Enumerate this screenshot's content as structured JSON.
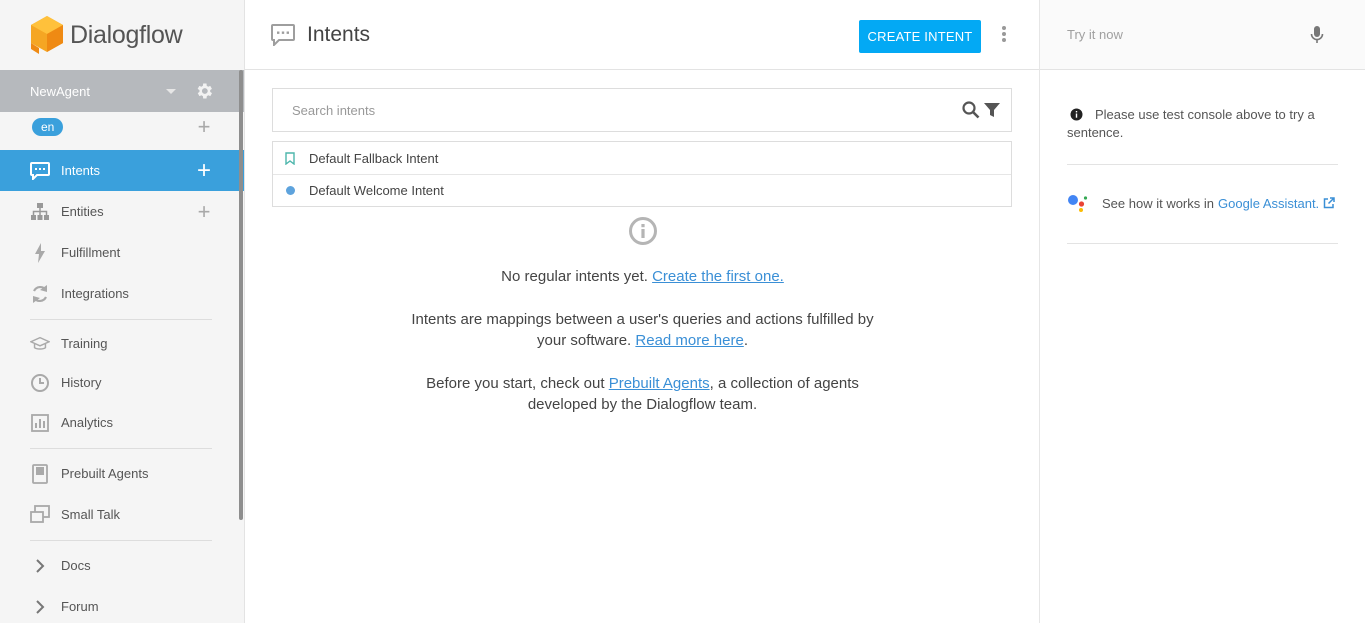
{
  "brand": {
    "name": "Dialogflow"
  },
  "agent": {
    "name": "NewAgent",
    "language": "en"
  },
  "sidebar": {
    "items": [
      {
        "label": "Intents",
        "icon": "chat-icon",
        "active": true,
        "has_add": true
      },
      {
        "label": "Entities",
        "icon": "hierarchy-icon",
        "active": false,
        "has_add": true
      },
      {
        "label": "Fulfillment",
        "icon": "bolt-icon",
        "active": false
      },
      {
        "label": "Integrations",
        "icon": "sync-icon",
        "active": false
      },
      {
        "label": "Training",
        "icon": "graduation-cap-icon",
        "active": false
      },
      {
        "label": "History",
        "icon": "clock-icon",
        "active": false
      },
      {
        "label": "Analytics",
        "icon": "bar-chart-icon",
        "active": false
      },
      {
        "label": "Prebuilt Agents",
        "icon": "book-icon",
        "active": false
      },
      {
        "label": "Small Talk",
        "icon": "chat-bubbles-icon",
        "active": false
      },
      {
        "label": "Docs",
        "icon": "chevron-right-icon",
        "active": false
      },
      {
        "label": "Forum",
        "icon": "chevron-right-icon",
        "active": false
      }
    ]
  },
  "main": {
    "title": "Intents",
    "create_label": "CREATE INTENT",
    "search": {
      "placeholder": "Search intents",
      "value": ""
    },
    "intents": [
      {
        "name": "Default Fallback Intent",
        "icon": "bookmark-icon"
      },
      {
        "name": "Default Welcome Intent",
        "icon": "dot-icon"
      }
    ],
    "empty": {
      "line1_text": "No regular intents yet.",
      "line1_link": "Create the first one.",
      "line2_text": "Intents are mappings between a user's queries and actions fulfilled by your software.",
      "line2_link": "Read more here",
      "line2_end": ".",
      "line3_text": "Before you start, check out",
      "line3_link": "Prebuilt Agents",
      "line3_end": ", a collection of agents developed by the Dialogflow team."
    }
  },
  "right": {
    "try_placeholder": "Try it now",
    "info_text": "Please use test console above to try a sentence.",
    "ga_text": "See how it works in",
    "ga_link": "Google Assistant."
  },
  "colors": {
    "accent": "#3aa0dc",
    "button": "#03a9f4",
    "link": "#3a8fd6",
    "logo": "#f5a623"
  }
}
